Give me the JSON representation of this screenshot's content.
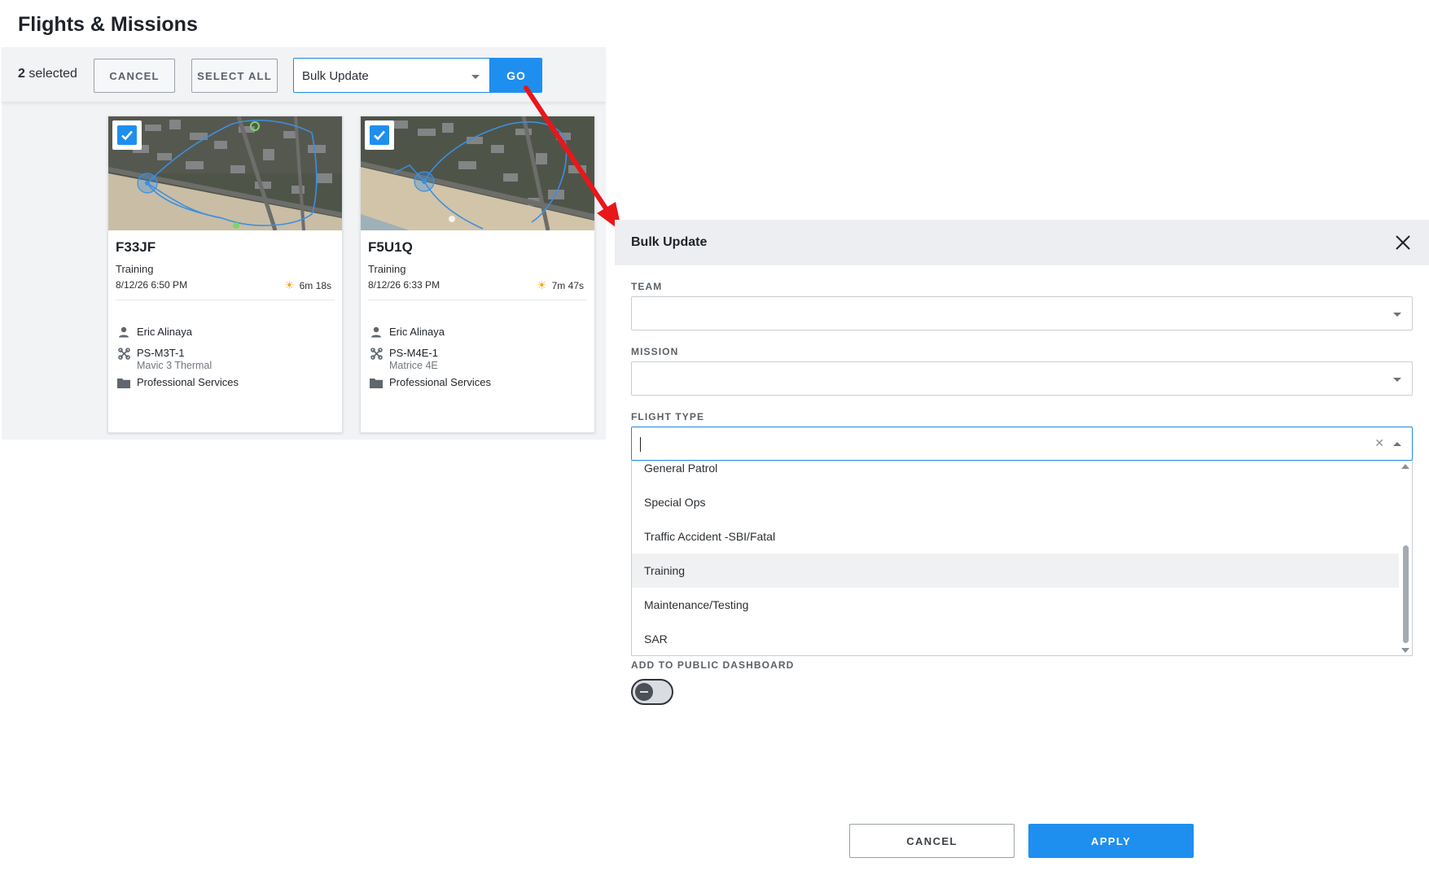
{
  "page": {
    "title": "Flights & Missions"
  },
  "toolbar": {
    "selected_count": "2",
    "selected_suffix": "selected",
    "cancel_label": "CANCEL",
    "select_all_label": "SELECT ALL",
    "action_select_value": "Bulk Update",
    "go_label": "GO"
  },
  "cards": [
    {
      "id": "F33JF",
      "type": "Training",
      "date": "8/12/26 6:50 PM",
      "duration_min": "6",
      "duration_min_unit": "m",
      "duration_sec": "18",
      "duration_sec_unit": "s",
      "pilot": "Eric Alinaya",
      "aircraft": "PS-M3T-1",
      "aircraft_model": "Mavic 3 Thermal",
      "team": "Professional Services",
      "checked": true
    },
    {
      "id": "F5U1Q",
      "type": "Training",
      "date": "8/12/26 6:33 PM",
      "duration_min": "7",
      "duration_min_unit": "m",
      "duration_sec": "47",
      "duration_sec_unit": "s",
      "pilot": "Eric Alinaya",
      "aircraft": "PS-M4E-1",
      "aircraft_model": "Matrice 4E",
      "team": "Professional Services",
      "checked": true
    }
  ],
  "bulk_update": {
    "title": "Bulk Update",
    "team_label": "TEAM",
    "team_value": "",
    "mission_label": "MISSION",
    "mission_value": "",
    "flight_type_label": "FLIGHT TYPE",
    "flight_type_value": "",
    "flight_type_options": [
      "General Patrol",
      "Special Ops",
      "Traffic Accident -SBI/Fatal",
      "Training",
      "Maintenance/Testing",
      "SAR"
    ],
    "highlighted_option": "Training",
    "public_dashboard_label": "ADD TO PUBLIC DASHBOARD",
    "public_dashboard_on": false,
    "cancel_label": "CANCEL",
    "apply_label": "APPLY"
  },
  "colors": {
    "accent": "#1e8fef",
    "annotation_arrow": "#e8171b",
    "route_line": "#3d8fe0",
    "duration_icon": "#f5a623"
  },
  "icons": {
    "pilot": "person-icon",
    "aircraft": "drone-icon",
    "team": "folder-icon",
    "weather": "sun-icon",
    "close": "close-icon",
    "checkbox": "checkbox-checked-icon"
  }
}
